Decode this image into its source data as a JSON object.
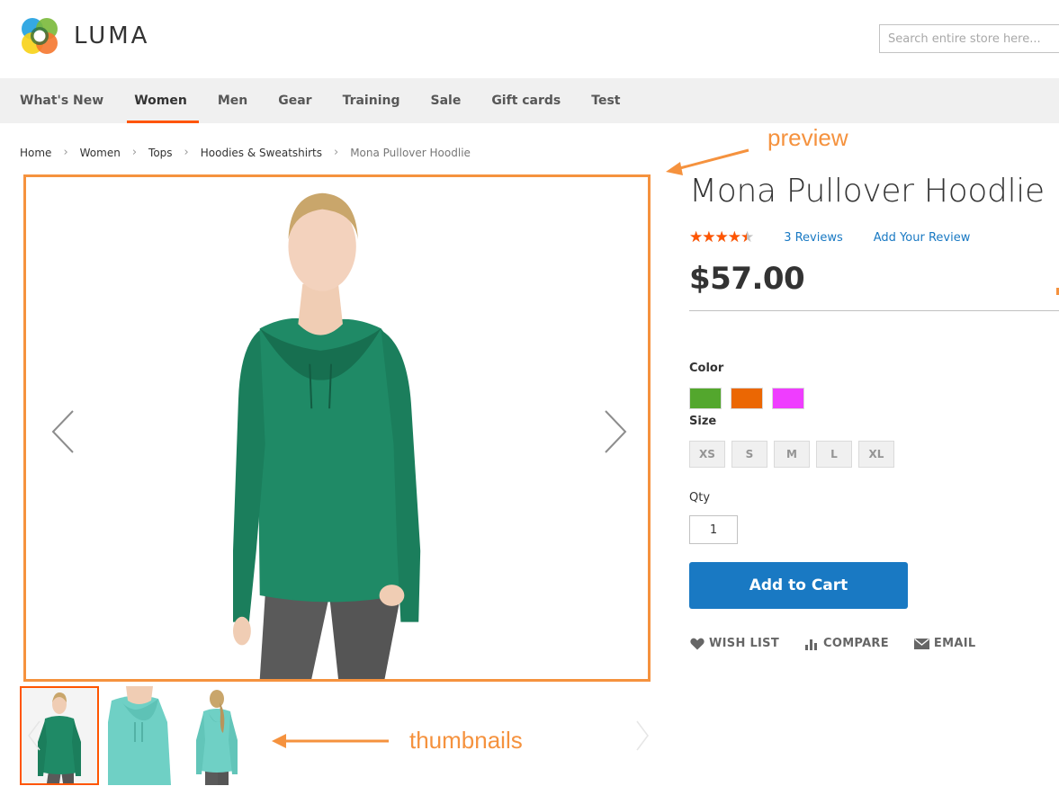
{
  "header": {
    "logo_text": "LUMA",
    "search_placeholder": "Search entire store here..."
  },
  "nav": {
    "items": [
      {
        "label": "What's New",
        "active": false
      },
      {
        "label": "Women",
        "active": true
      },
      {
        "label": "Men",
        "active": false
      },
      {
        "label": "Gear",
        "active": false
      },
      {
        "label": "Training",
        "active": false
      },
      {
        "label": "Sale",
        "active": false
      },
      {
        "label": "Gift cards",
        "active": false
      },
      {
        "label": "Test",
        "active": false
      }
    ]
  },
  "breadcrumb": {
    "items": [
      "Home",
      "Women",
      "Tops",
      "Hoodies & Sweatshirts"
    ],
    "current": "Mona Pullover Hoodlie",
    "separator": ">"
  },
  "annotations": {
    "preview": "preview",
    "thumbnails": "thumbnails",
    "color": "#f5923e"
  },
  "gallery": {
    "prev_icon": "chevron-left-icon",
    "next_icon": "chevron-right-icon",
    "thumbnails": [
      {
        "name": "front-green",
        "active": true
      },
      {
        "name": "front-closeup-aqua",
        "active": false
      },
      {
        "name": "back-aqua",
        "active": false
      }
    ]
  },
  "product": {
    "title": "Mona Pullover Hoodlie",
    "rating_percent": 90,
    "reviews_link": "3 Reviews",
    "add_review_link": "Add Your Review",
    "price": "$57.00",
    "color_label": "Color",
    "colors": [
      {
        "name": "Green",
        "hex": "#53a72d"
      },
      {
        "name": "Orange",
        "hex": "#eb6703"
      },
      {
        "name": "Purple",
        "hex": "#ef3dff"
      }
    ],
    "size_label": "Size",
    "sizes": [
      "XS",
      "S",
      "M",
      "L",
      "XL"
    ],
    "qty_label": "Qty",
    "qty_value": "1",
    "add_to_cart": "Add to Cart",
    "actions": [
      {
        "label": "Wish List",
        "icon": "heart-icon"
      },
      {
        "label": "Compare",
        "icon": "bar-chart-icon"
      },
      {
        "label": "Email",
        "icon": "envelope-icon"
      }
    ]
  },
  "colors": {
    "accent": "#ff5501",
    "primary_button": "#1979c3",
    "link": "#1979c3",
    "nav_bg": "#f0f0f0"
  }
}
